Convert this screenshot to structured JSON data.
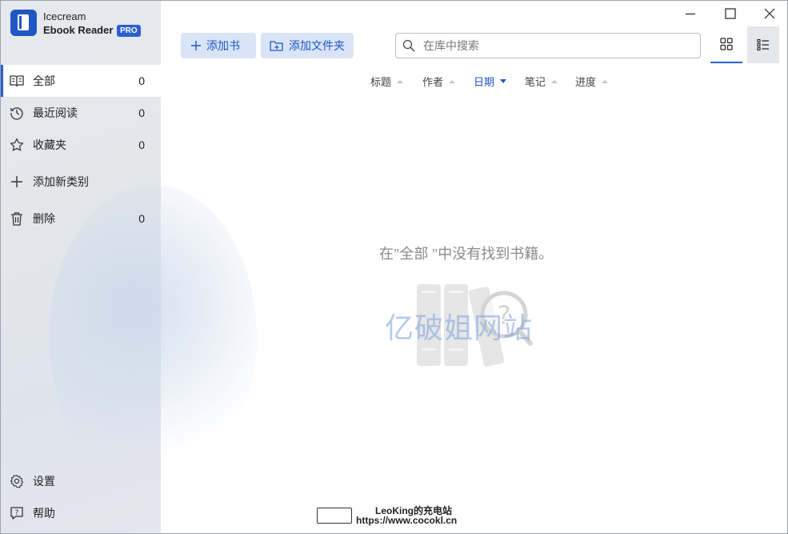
{
  "app": {
    "name_line1": "Icecream",
    "name_line2": "Ebook Reader",
    "badge": "PRO",
    "accent_color": "#2a5fd0"
  },
  "sidebar": {
    "items": [
      {
        "label": "全部",
        "count": "0",
        "icon": "book-open-icon",
        "active": true
      },
      {
        "label": "最近阅读",
        "count": "0",
        "icon": "history-icon"
      },
      {
        "label": "收藏夹",
        "count": "0",
        "icon": "star-icon"
      },
      {
        "label": "添加新类别",
        "icon": "plus-icon"
      },
      {
        "label": "删除",
        "count": "0",
        "icon": "trash-icon"
      }
    ],
    "bottom": [
      {
        "label": "设置",
        "icon": "gear-icon"
      },
      {
        "label": "帮助",
        "icon": "help-icon"
      }
    ]
  },
  "toolbar": {
    "add_book": "添加书",
    "add_folder": "添加文件夹",
    "search_placeholder": "在库中搜索"
  },
  "sort": {
    "columns": [
      "标题",
      "作者",
      "日期",
      "笔记",
      "进度"
    ],
    "active": "日期"
  },
  "main": {
    "empty_message": "在\"全部 \"中没有找到书籍。"
  },
  "overlay": {
    "watermark": "亿破姐网站",
    "footer_line1": "LeoKing的充电站",
    "footer_line2": "https://www.cocokl.cn"
  }
}
